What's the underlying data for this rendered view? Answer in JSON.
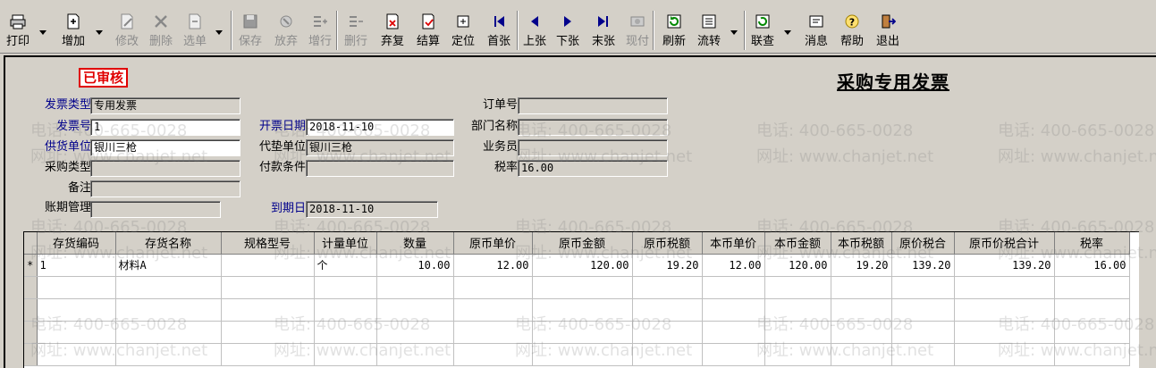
{
  "toolbar": {
    "items": [
      {
        "label": "打印",
        "icon": "printer-icon",
        "enabled": true
      },
      {
        "label": "增加",
        "icon": "add-doc-icon",
        "enabled": true
      },
      {
        "label": "修改",
        "icon": "edit-icon",
        "enabled": false
      },
      {
        "label": "删除",
        "icon": "delete-icon",
        "enabled": false
      },
      {
        "label": "选单",
        "icon": "select-doc-icon",
        "enabled": false
      },
      {
        "label": "保存",
        "icon": "save-icon",
        "enabled": false
      },
      {
        "label": "放弃",
        "icon": "discard-icon",
        "enabled": false
      },
      {
        "label": "增行",
        "icon": "add-row-icon",
        "enabled": false
      },
      {
        "label": "删行",
        "icon": "delete-row-icon",
        "enabled": false
      },
      {
        "label": "弃复",
        "icon": "cancel-review-icon",
        "enabled": true
      },
      {
        "label": "结算",
        "icon": "settle-icon",
        "enabled": true
      },
      {
        "label": "定位",
        "icon": "locate-icon",
        "enabled": true
      },
      {
        "label": "首张",
        "icon": "first-record-icon",
        "enabled": true
      },
      {
        "label": "上张",
        "icon": "prev-record-icon",
        "enabled": true
      },
      {
        "label": "下张",
        "icon": "next-record-icon",
        "enabled": true
      },
      {
        "label": "末张",
        "icon": "last-record-icon",
        "enabled": true
      },
      {
        "label": "现付",
        "icon": "cash-pay-icon",
        "enabled": false
      },
      {
        "label": "刷新",
        "icon": "refresh-icon",
        "enabled": true
      },
      {
        "label": "流转",
        "icon": "flow-icon",
        "enabled": true
      },
      {
        "label": "联查",
        "icon": "query-icon",
        "enabled": true
      },
      {
        "label": "消息",
        "icon": "message-icon",
        "enabled": true
      },
      {
        "label": "帮助",
        "icon": "help-icon",
        "enabled": true
      },
      {
        "label": "退出",
        "icon": "exit-icon",
        "enabled": true
      }
    ]
  },
  "header": {
    "status": "已审核",
    "title": "采购专用发票"
  },
  "form": {
    "invoice_type": {
      "label": "发票类型",
      "value": "专用发票"
    },
    "invoice_no": {
      "label": "发票号",
      "value": "1"
    },
    "supplier": {
      "label": "供货单位",
      "value": "银川三枪"
    },
    "purchase_type": {
      "label": "采购类型",
      "value": ""
    },
    "remark": {
      "label": "备注",
      "value": ""
    },
    "account_period": {
      "label": "账期管理",
      "value": ""
    },
    "invoice_date": {
      "label": "开票日期",
      "value": "2018-11-10"
    },
    "agent_unit": {
      "label": "代垫单位",
      "value": "银川三枪"
    },
    "payment_terms": {
      "label": "付款条件",
      "value": ""
    },
    "due_date": {
      "label": "到期日",
      "value": "2018-11-10"
    },
    "order_no": {
      "label": "订单号",
      "value": ""
    },
    "department": {
      "label": "部门名称",
      "value": ""
    },
    "salesman": {
      "label": "业务员",
      "value": ""
    },
    "tax_rate": {
      "label": "税率",
      "value": "16.00"
    }
  },
  "grid": {
    "columns": [
      "存货编码",
      "存货名称",
      "规格型号",
      "计量单位",
      "数量",
      "原币单价",
      "原币金额",
      "原币税额",
      "本币单价",
      "本币金额",
      "本币税额",
      "原价税合",
      "原币价税合计",
      "税率"
    ],
    "rows": [
      {
        "marker": "*",
        "cells": [
          "1",
          "材料A",
          "",
          "个",
          "10.00",
          "12.00",
          "120.00",
          "19.20",
          "12.00",
          "120.00",
          "19.20",
          "139.20",
          "139.20",
          "16.00"
        ]
      }
    ]
  },
  "watermark": {
    "phone": "电话: 400-665-0028",
    "site": "网址: www.chanjet.net"
  }
}
